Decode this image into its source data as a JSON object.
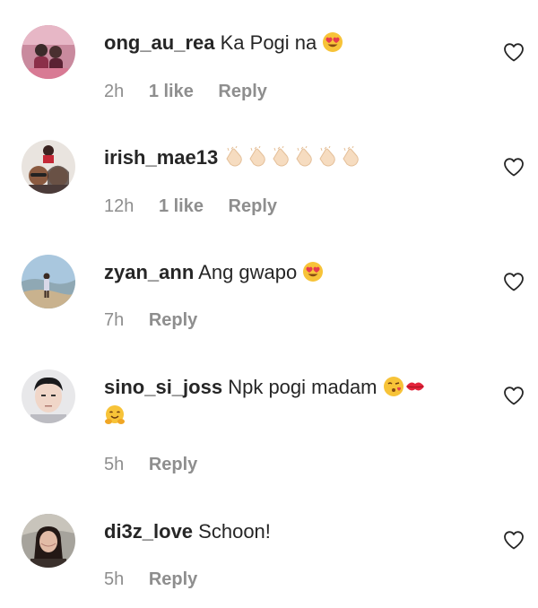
{
  "comments": [
    {
      "username": "ong_au_rea",
      "text": "Ka Pogi na",
      "emoji": [
        "heart-eyes"
      ],
      "time": "2h",
      "likes": "1 like",
      "reply": "Reply"
    },
    {
      "username": "irish_mae13",
      "text": "",
      "emoji": [
        "clapping-hands",
        "clapping-hands",
        "clapping-hands",
        "clapping-hands",
        "clapping-hands",
        "clapping-hands"
      ],
      "time": "12h",
      "likes": "1 like",
      "reply": "Reply"
    },
    {
      "username": "zyan_ann",
      "text": "Ang gwapo",
      "emoji": [
        "heart-eyes"
      ],
      "time": "7h",
      "likes": "",
      "reply": "Reply"
    },
    {
      "username": "sino_si_joss",
      "text": "Npk pogi madam",
      "emoji": [
        "face-blowing-kiss",
        "kiss-mark",
        "hugging-face"
      ],
      "time": "5h",
      "likes": "",
      "reply": "Reply"
    },
    {
      "username": "di3z_love",
      "text": "Schoon!",
      "emoji": [],
      "time": "5h",
      "likes": "",
      "reply": "Reply"
    }
  ],
  "colors": {
    "text": "#262626",
    "meta": "#8e8e8e",
    "heart_outline": "#262626"
  }
}
